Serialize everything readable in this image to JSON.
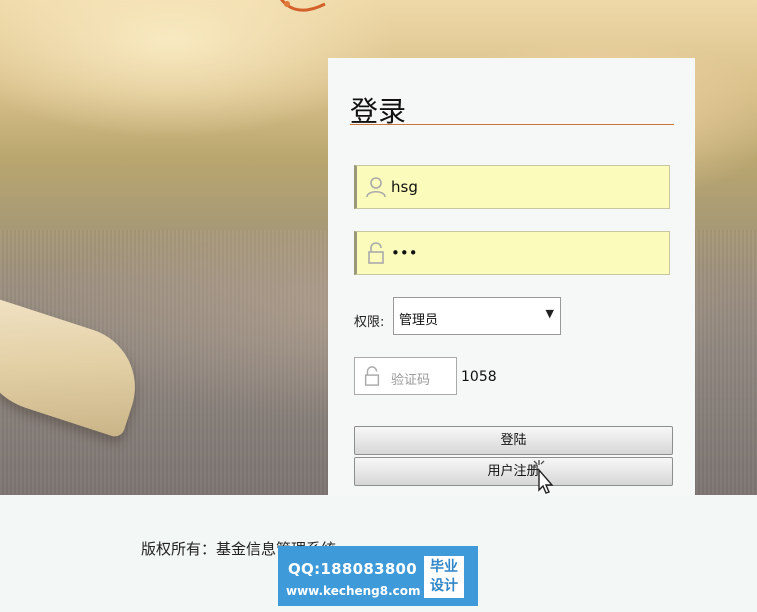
{
  "login": {
    "title": "登录",
    "username_value": "hsg",
    "password_value": "•••",
    "role_label": "权限:",
    "role_selected": "管理员",
    "captcha_placeholder": "验证码",
    "captcha_code": "1058",
    "login_button": "登陆",
    "register_button": "用户注册"
  },
  "footer": {
    "copyright": "版权所有：基金信息管理系统"
  },
  "watermark": {
    "qq": "QQ:188083800",
    "url": "www.kecheng8.com",
    "tag_line1": "毕业",
    "tag_line2": "设计"
  },
  "colors": {
    "field_bg": "#fbfbbb",
    "title_underline": "#c8793a",
    "watermark_bg": "#3e9ad9"
  },
  "icons": {
    "username": "user-icon",
    "password": "lock-icon",
    "captcha": "lock-icon",
    "role_dropdown": "caret-down-icon",
    "cursor": "pointer-cursor-icon"
  }
}
